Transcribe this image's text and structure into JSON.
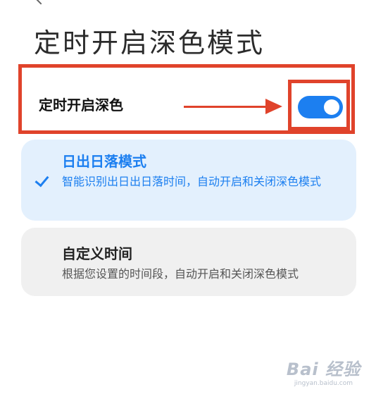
{
  "page": {
    "title": "定时开启深色模式"
  },
  "toggle": {
    "label": "定时开启深色",
    "state": "on",
    "accent_color": "#1c7ff0",
    "annotation_color": "#e0432b"
  },
  "options": [
    {
      "title": "日出日落模式",
      "description": "智能识别出日出日落时间，自动开启和关闭深色模式",
      "selected": true,
      "icon": "check-icon"
    },
    {
      "title": "自定义时间",
      "description": "根据您设置的时间段，自动开启和关闭深色模式",
      "selected": false
    }
  ],
  "watermark": {
    "logo": "Bai  经验",
    "url": "jingyan.baidu.com"
  }
}
